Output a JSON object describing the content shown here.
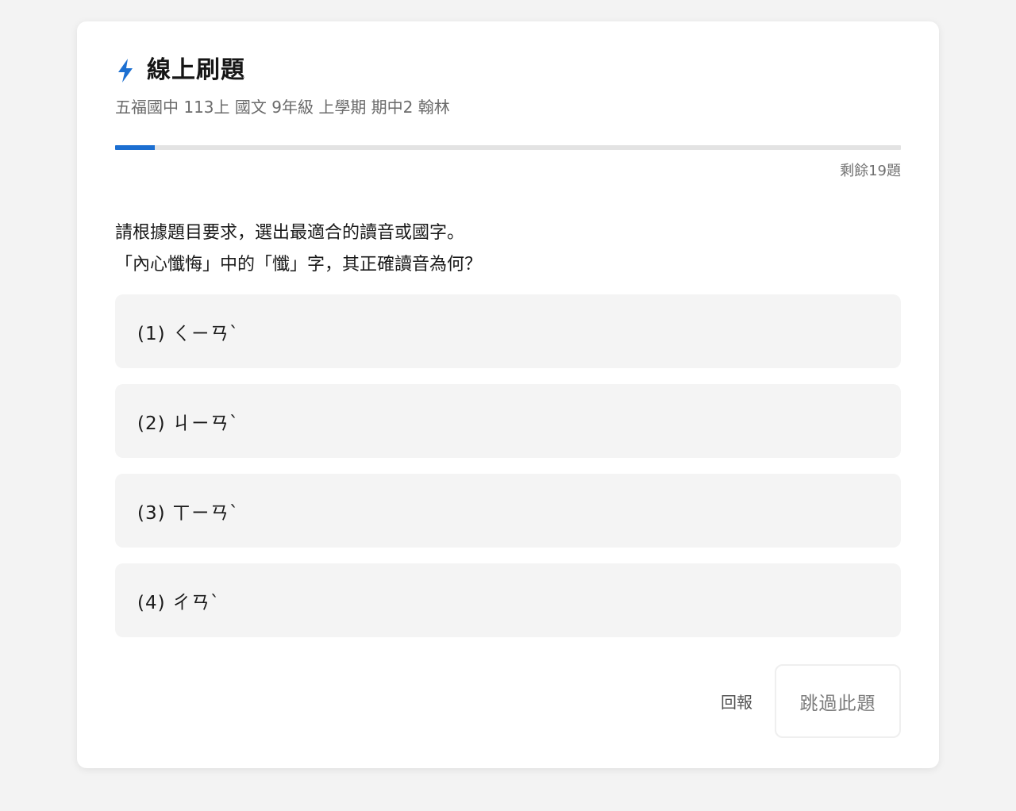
{
  "colors": {
    "accent": "#1c6fd1",
    "background": "#f3f3f3",
    "card": "#ffffff",
    "option_bg": "#f4f4f4"
  },
  "header": {
    "icon": "lightning-bolt-icon",
    "title": "線上刷題",
    "subtitle": "五福國中 113上 國文 9年級 上學期 期中2 翰林"
  },
  "progress": {
    "fraction": 0.05,
    "remaining_text": "剩餘19題"
  },
  "question": {
    "instruction": "請根據題目要求，選出最適合的讀音或國字。",
    "prompt": "「內心懺悔」中的「懺」字，其正確讀音為何？"
  },
  "options": [
    {
      "label": "(1) ㄑㄧㄢˋ"
    },
    {
      "label": "(2) ㄐㄧㄢˋ"
    },
    {
      "label": "(3) ㄒㄧㄢˋ"
    },
    {
      "label": "(4) ㄔㄢˋ"
    }
  ],
  "actions": {
    "report_label": "回報",
    "skip_label": "跳過此題"
  }
}
